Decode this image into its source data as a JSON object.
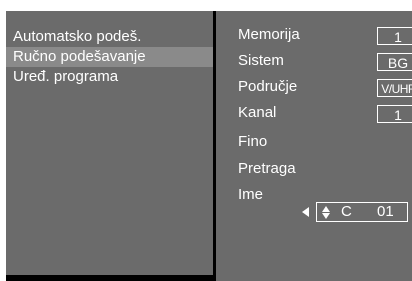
{
  "colors": {
    "panel_bg": "#6b6b6b",
    "selected_bg": "#8a8a8a",
    "text": "#ffffff",
    "frame": "#000000"
  },
  "menu": {
    "items": [
      {
        "label": "Automatsko podeš."
      },
      {
        "label": "Ručno podešavanje",
        "selected": true
      },
      {
        "label": "Uređ. programa"
      }
    ]
  },
  "settings": {
    "memorija": {
      "label": "Memorija",
      "value": "1"
    },
    "sistem": {
      "label": "Sistem",
      "value": "BG"
    },
    "podrucje": {
      "label": "Područje",
      "value": "V/UHF"
    },
    "kanal": {
      "label": "Kanal",
      "value": "1"
    },
    "fino": {
      "label": "Fino"
    },
    "pretraga": {
      "label": "Pretraga"
    },
    "ime": {
      "label": "Ime",
      "letter": "C",
      "number": "01",
      "icons": [
        "arrow-left-icon",
        "up-down-arrow-icon",
        "arrow-right-icon"
      ]
    }
  }
}
